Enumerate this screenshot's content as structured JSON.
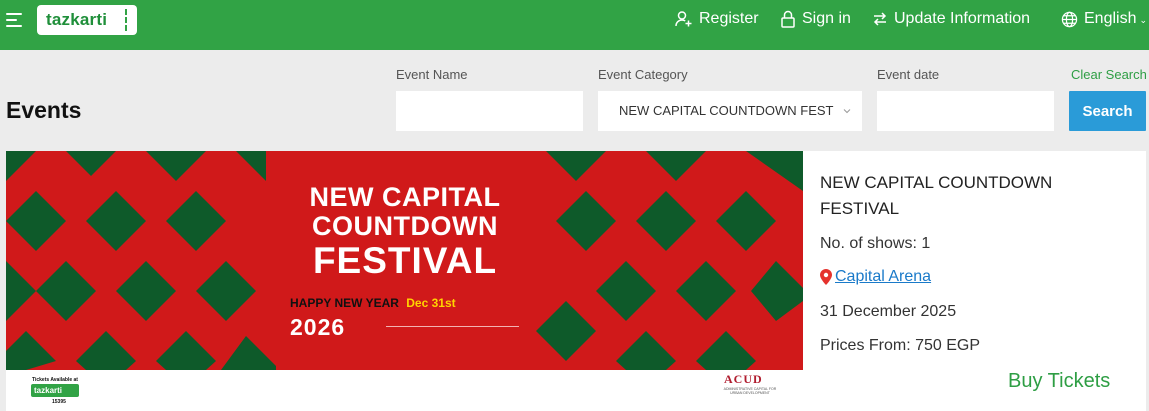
{
  "header": {
    "logo_text": "tazkarti",
    "nav": {
      "register": "Register",
      "sign_in": "Sign in",
      "update_info": "Update Information",
      "language": "English"
    }
  },
  "search": {
    "page_title": "Events",
    "event_name_label": "Event Name",
    "event_name_value": "",
    "event_category_label": "Event Category",
    "event_category_value": "NEW CAPITAL COUNTDOWN FEST",
    "event_date_label": "Event date",
    "event_date_value": "",
    "clear_label": "Clear Search",
    "search_label": "Search"
  },
  "event": {
    "poster": {
      "line1": "NEW CAPITAL",
      "line2": "COUNTDOWN",
      "line3": "FESTIVAL",
      "happy": "HAPPY NEW YEAR",
      "date": "Dec 31st",
      "year": "2026",
      "tickets_available": "Tickets Available at",
      "mini_logo": "tazkarti",
      "hotline": "15395",
      "partner_logo": "ACUD",
      "partner_sub": "ADMINISTRATIVE CAPITAL FOR URBAN DEVELOPMENT"
    },
    "title": "NEW CAPITAL COUNTDOWN FESTIVAL",
    "shows": "No. of shows: 1",
    "venue": "Capital Arena",
    "date": "31 December 2025",
    "prices": "Prices From: 750 EGP",
    "buy_label": "Buy Tickets"
  },
  "colors": {
    "header_green": "#31a345",
    "search_blue": "#2a9bd8",
    "poster_red": "#d0191a",
    "poster_green": "#0e5a2a",
    "link_blue": "#1a7ac9"
  }
}
